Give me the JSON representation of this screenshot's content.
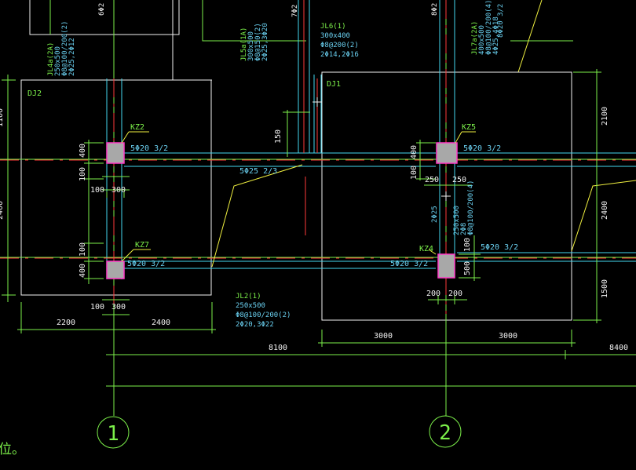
{
  "colors": {
    "background": "#000000",
    "axis": "#7cf04a",
    "dimension": "#7cf04a",
    "foundation_outline": "#f2f2f2",
    "beam_edge": "#44d8f0",
    "leader": "#f0f040",
    "rebar": "#ff3a3a",
    "column_fill": "#a8a8a8",
    "column_edge": "#ff3ac8",
    "annotation_text": "#6ad0f0",
    "label_text": "#7cf04a"
  },
  "axes": {
    "a1": "1",
    "a2": "2"
  },
  "foundations": {
    "dj2": "DJ2",
    "dj1": "DJ1"
  },
  "columns": {
    "kz2": {
      "name": "KZ2",
      "rebar": "5Φ20 3/2"
    },
    "kz5": {
      "name": "KZ5",
      "rebar": "5Φ20 3/2"
    },
    "kz7": {
      "name": "KZ7",
      "rebar": "5Φ20 3/2"
    },
    "kz4": {
      "name": "KZ4",
      "rebar": "5Φ20 3/2",
      "rebar_right": "5Φ20 3/2"
    }
  },
  "beam_mid_rebar": "5Φ25 2/3",
  "beams": {
    "jl4a": [
      "JL4a(2A)",
      "250x500",
      "Φ8@100/200(2)",
      "2Φ25,2Φ12"
    ],
    "jl5a": [
      "JL5a(1A)",
      "300x500",
      "Φ8@150(2)",
      "2Φ25,3Φ20"
    ],
    "jl6": [
      "JL6(1)",
      "300x400",
      "Φ8@200(2)",
      "2Φ14,2Φ16"
    ],
    "jl7a": [
      "JL7a(2A)",
      "400x500",
      "Φ8@100/200(4)",
      "4Φ25,4Φ18"
    ],
    "jl2": [
      "JL2(1)",
      "250x500",
      "Φ8@100/200(2)",
      "2Φ20,3Φ22"
    ],
    "col_beam": [
      "250x500",
      "2Φ8",
      "Φ8@100/200(4)"
    ],
    "col_beam_bar": "2Φ25"
  },
  "top_cut": {
    "t1": "6Φ2",
    "t2": "7Φ2",
    "t3": "8Φ2",
    "t4": "8Φ20 3/2"
  },
  "dims": {
    "d2200": "2200",
    "d2400": "2400",
    "d3000a": "3000",
    "d3000b": "3000",
    "d8100": "8100",
    "d8400": "8400",
    "v2100": "2100",
    "v2400": "2400",
    "v1500": "1500",
    "v150": "150",
    "v400a": "400",
    "v100a": "100",
    "v100b": "100",
    "v400b": "400",
    "v400c": "400",
    "v100c": "100",
    "v100d": "100",
    "v500": "500",
    "v1100l": "1100",
    "v2400l": "2400",
    "h100a": "100",
    "h300a": "300",
    "h100b": "100",
    "h300b": "300",
    "h250a": "250",
    "h250b": "250",
    "h200a": "200",
    "h200b": "200"
  },
  "note": "位。"
}
